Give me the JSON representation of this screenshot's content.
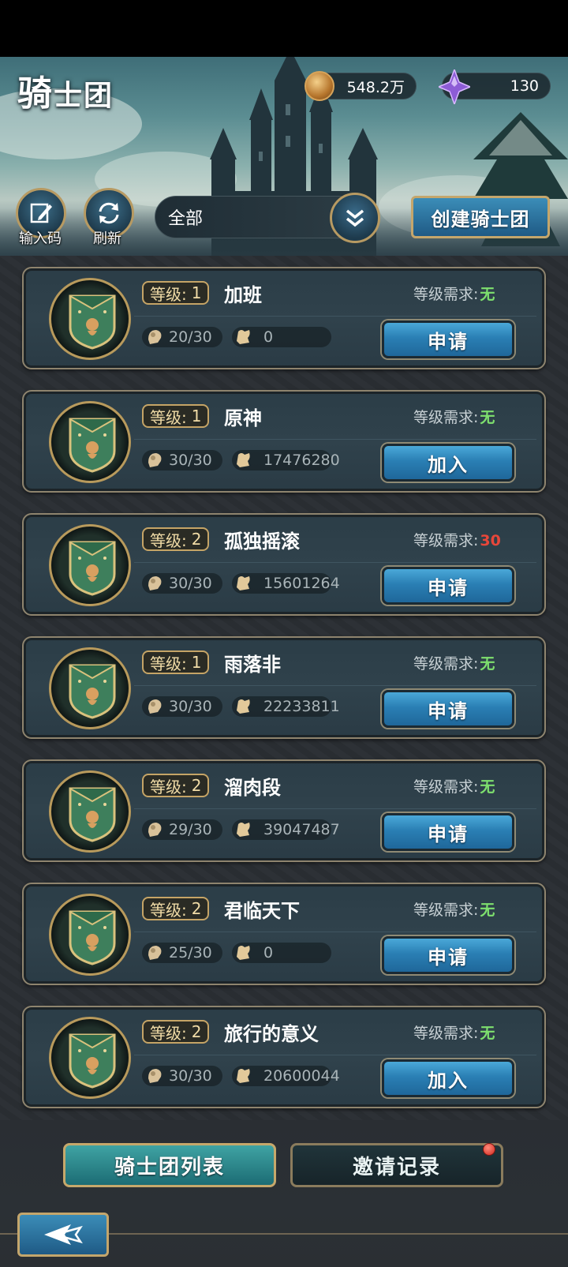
{
  "header": {
    "title_big": "骑",
    "title_small": "士团",
    "coins": "548.2万",
    "gems": "130",
    "input_code_label": "输入码",
    "refresh_label": "刷新",
    "filter_value": "全部",
    "create_button": "创建骑士团"
  },
  "labels": {
    "level_prefix": "等级:",
    "requirement_prefix": "等级需求:"
  },
  "colors": {
    "req_ok": "#7ee06e",
    "req_high": "#e8473a",
    "accent_gold": "#c5a466",
    "button_blue": "#2a7fb4"
  },
  "guilds": [
    {
      "level": "1",
      "name": "加班",
      "requirement": "无",
      "members": "20/30",
      "power": "0",
      "action": "申请"
    },
    {
      "level": "1",
      "name": "原神",
      "requirement": "无",
      "members": "30/30",
      "power": "17476280",
      "action": "加入"
    },
    {
      "level": "2",
      "name": "孤独摇滚",
      "requirement": "30",
      "members": "30/30",
      "power": "15601264",
      "action": "申请"
    },
    {
      "level": "1",
      "name": "雨落非",
      "requirement": "无",
      "members": "30/30",
      "power": "22233811",
      "action": "申请"
    },
    {
      "level": "2",
      "name": "溜肉段",
      "requirement": "无",
      "members": "29/30",
      "power": "39047487",
      "action": "申请"
    },
    {
      "level": "2",
      "name": "君临天下",
      "requirement": "无",
      "members": "25/30",
      "power": "0",
      "action": "申请"
    },
    {
      "level": "2",
      "name": "旅行的意义",
      "requirement": "无",
      "members": "30/30",
      "power": "20600044",
      "action": "加入"
    }
  ],
  "tabs": {
    "list": "骑士团列表",
    "invites": "邀请记录"
  }
}
